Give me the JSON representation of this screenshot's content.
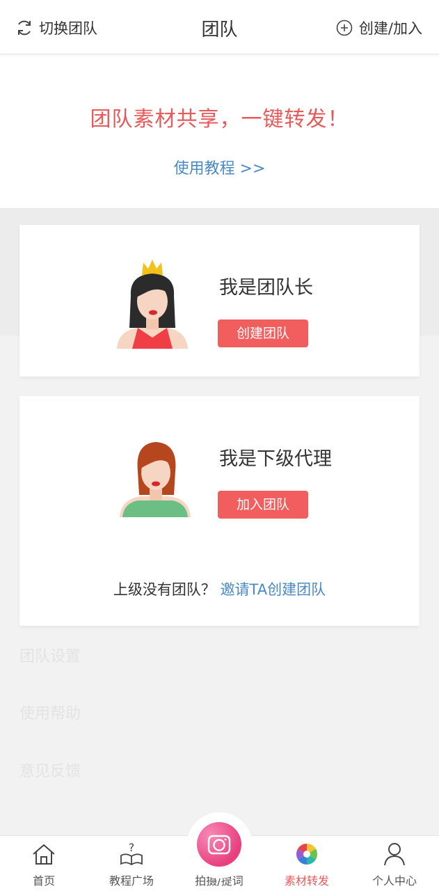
{
  "header": {
    "switch_label": "切换团队",
    "title": "团队",
    "create_join_label": "创建/加入"
  },
  "banner": {
    "slogan": "团队素材共享，一键转发！",
    "tutorial_link": "使用教程 >>"
  },
  "leader_card": {
    "role": "我是团队长",
    "button": "创建团队"
  },
  "agent_card": {
    "role": "我是下级代理",
    "button": "加入团队",
    "invite_question": "上级没有团队？",
    "invite_link": "邀请TA创建团队"
  },
  "background_menu": {
    "items": [
      "团队设置",
      "使用帮助",
      "意见反馈"
    ]
  },
  "bottom_nav": {
    "items": [
      {
        "label": "首页",
        "icon": "home-icon"
      },
      {
        "label": "教程广场",
        "icon": "tutorial-book-icon"
      },
      {
        "label": "拍摄/提词",
        "icon": "camera-icon"
      },
      {
        "label": "素材转发",
        "icon": "color-wheel-icon"
      },
      {
        "label": "个人中心",
        "icon": "user-icon"
      }
    ],
    "active": "素材转发"
  },
  "colors": {
    "accent_red": "#e85a5a",
    "button_red": "#f25e5e",
    "link_blue": "#4a8ac4"
  }
}
